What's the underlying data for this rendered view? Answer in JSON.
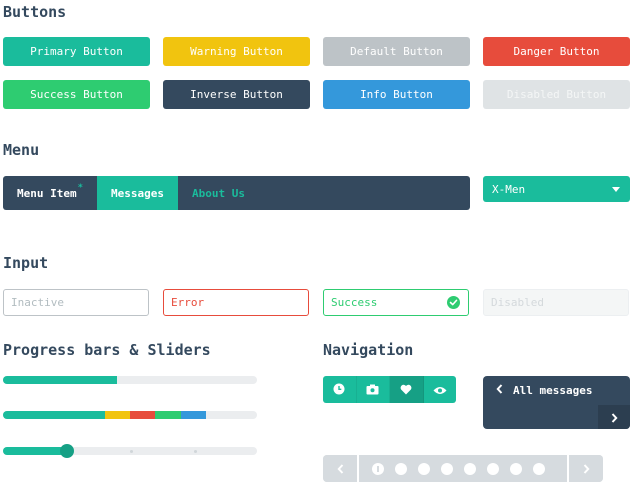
{
  "sections": {
    "buttons": "Buttons",
    "menu": "Menu",
    "input": "Input",
    "progress": "Progress bars & Sliders",
    "navigation": "Navigation"
  },
  "buttons": [
    {
      "label": "Primary Button",
      "color": "#1abc9c"
    },
    {
      "label": "Warning Button",
      "color": "#f1c40f"
    },
    {
      "label": "Default Button",
      "color": "#bdc3c7"
    },
    {
      "label": "Danger Button",
      "color": "#e74c3c"
    },
    {
      "label": "Success Button",
      "color": "#2ecc71"
    },
    {
      "label": "Inverse Button",
      "color": "#34495e"
    },
    {
      "label": "Info Button",
      "color": "#3498db"
    },
    {
      "label": "Disabled Button",
      "color": "#dfe3e5"
    }
  ],
  "menu": {
    "items": [
      {
        "label": "Menu Item",
        "badge": "*"
      },
      {
        "label": "Messages"
      },
      {
        "label": "About Us"
      }
    ],
    "select": {
      "value": "X-Men"
    }
  },
  "inputs": {
    "inactive": {
      "placeholder": "Inactive"
    },
    "error": {
      "value": "Error"
    },
    "success": {
      "value": "Success"
    },
    "disabled": {
      "placeholder": "Disabled"
    }
  },
  "progress": {
    "bar1": {
      "value": 0.45,
      "color": "#1abc9c"
    },
    "bar2": {
      "segments": [
        {
          "value": 0.4,
          "color": "#1abc9c"
        },
        {
          "value": 0.1,
          "color": "#f1c40f"
        },
        {
          "value": 0.1,
          "color": "#e74c3c"
        },
        {
          "value": 0.1,
          "color": "#2ecc71"
        },
        {
          "value": 0.1,
          "color": "#3498db"
        }
      ]
    },
    "slider": {
      "value": 0.25,
      "marks": [
        0.5,
        0.75
      ]
    }
  },
  "navigation": {
    "group_icons": [
      "clock-icon",
      "camera-icon",
      "heart-icon",
      "eye-icon"
    ],
    "active_group_index": 2,
    "messages": {
      "label": "All messages"
    },
    "pager": {
      "page_count": 8,
      "active_index": 0
    }
  }
}
